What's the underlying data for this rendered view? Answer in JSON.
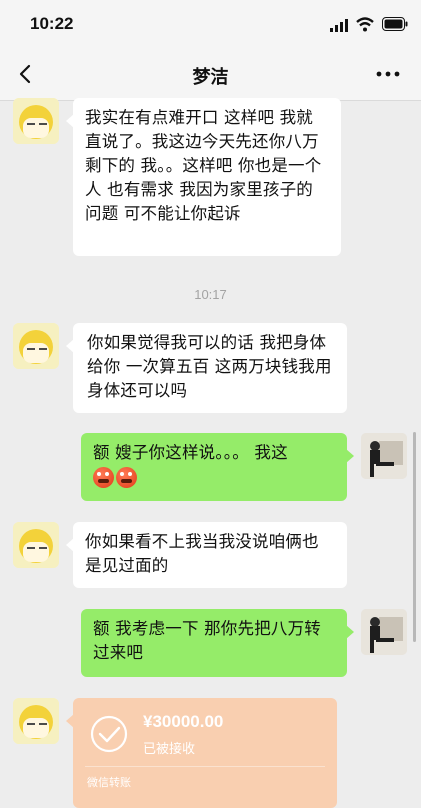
{
  "status_bar": {
    "time": "10:22"
  },
  "header": {
    "title": "梦洁"
  },
  "messages": [
    {
      "side": "left",
      "text": "我实在有点难开口 这样吧 我就直说了。我这边今天先还你八万 剩下的 我。。这样吧 你也是一个人 也有需求 我因为家里孩子的问题 可不能让你起诉"
    },
    {
      "side": "left",
      "text": "你如果觉得我可以的话 我把身体给你 一次算五百 这两万块钱我用身体还可以吗"
    },
    {
      "side": "right",
      "text": "额 嫂子你这样说。。。 我这"
    },
    {
      "side": "left",
      "text": "你如果看不上我当我没说咱俩也是见过面的"
    },
    {
      "side": "right",
      "text": "额 我考虑一下 那你先把八万转过来吧"
    }
  ],
  "timestamp": "10:17",
  "transfer": {
    "amount": "¥30000.00",
    "status": "已被接收",
    "label": "微信转账"
  },
  "colors": {
    "bg": "#ededed",
    "sent_bubble": "#95ec69",
    "received_bubble": "#ffffff",
    "transfer_card": "#f9cfb0"
  },
  "icons": [
    "signal-icon",
    "wifi-icon",
    "battery-icon",
    "back-arrow-icon",
    "more-icon",
    "emoji-icon",
    "check-circle-icon"
  ]
}
